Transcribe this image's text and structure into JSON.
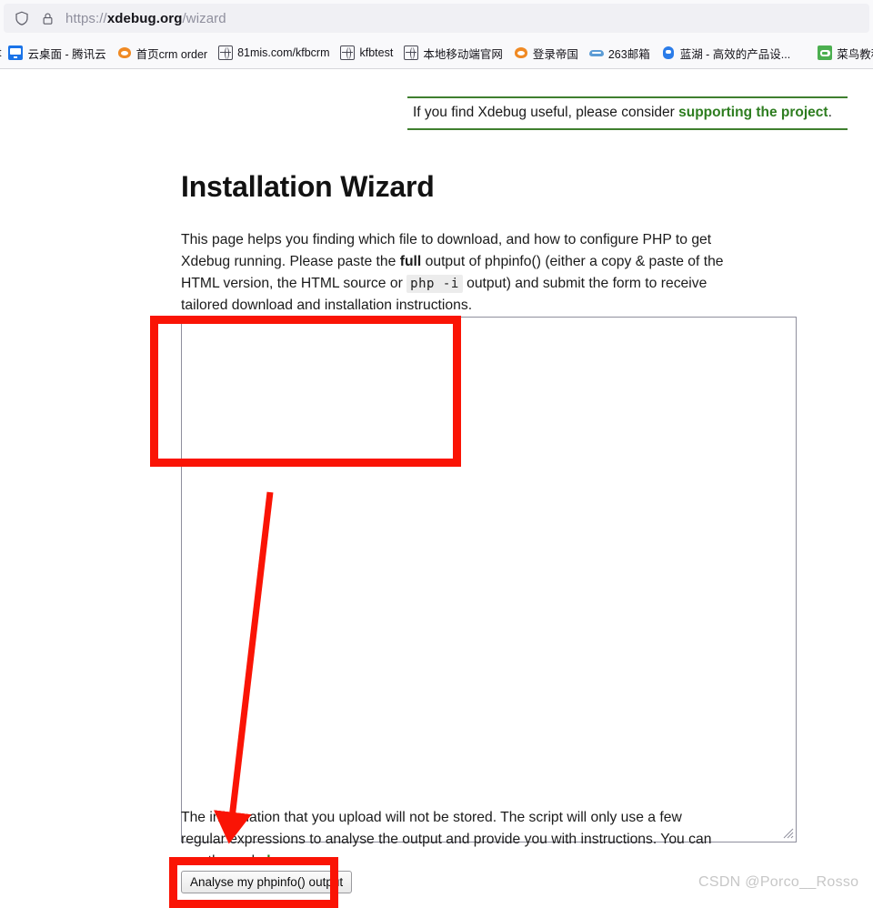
{
  "browser": {
    "urlbar": {
      "shield_icon": "shield-icon",
      "lock_icon": "lock-icon",
      "url_prefix": "https://",
      "url_host": "xdebug.org",
      "url_path": "/wizard",
      "full_url": "https://xdebug.org/wizard"
    },
    "bookmarks": {
      "clipped_left_label": "t",
      "items": [
        {
          "label": "云桌面 - 腾讯云",
          "icon": "tencent-cloud-desktop-icon"
        },
        {
          "label": "首页crm order",
          "icon": "firefox-bookmark-icon"
        },
        {
          "label": "81mis.com/kfbcrm",
          "icon": "globe-icon"
        },
        {
          "label": "kfbtest",
          "icon": "globe-icon"
        },
        {
          "label": "本地移动端官网",
          "icon": "globe-icon"
        },
        {
          "label": "登录帝国",
          "icon": "firefox-bookmark-icon"
        },
        {
          "label": "263邮箱",
          "icon": "cloud-mail-icon"
        },
        {
          "label": "蓝湖 - 高效的产品设...",
          "icon": "lanhu-icon"
        },
        {
          "label": "菜鸟教程",
          "icon": "runoob-icon"
        }
      ]
    }
  },
  "page": {
    "banner": {
      "text_before": "If you find Xdebug useful, please consider ",
      "link_text": "supporting the project",
      "text_after": ".",
      "border_color": "#3f7f2f",
      "link_color": "#2e7d20"
    },
    "title": "Installation Wizard",
    "intro": {
      "part1": "This page helps you finding which file to download, and how to configure PHP to get Xdebug running. Please paste the ",
      "bold1": "full",
      "part2": " output of phpinfo() (either a copy & paste of the HTML version, the HTML source or ",
      "code1": "php -i",
      "part3": " output) and submit the form to receive tailored download and installation instructions."
    },
    "textarea": {
      "value": "",
      "placeholder": ""
    },
    "notice": {
      "part1": "The information that you upload will not be stored. The script will only use a few regular expressions to analyse the output and provide you with instructions. You can see the code ",
      "link_text": "here",
      "part2": "."
    },
    "submit_button_label": "Analyse my phpinfo() output",
    "watermark": "CSDN @Porco__Rosso"
  },
  "annotations": {
    "color": "#fa1405",
    "box_textarea_label": "annotation-box-textarea",
    "box_button_label": "annotation-box-submit",
    "arrow_label": "annotation-arrow-down"
  }
}
